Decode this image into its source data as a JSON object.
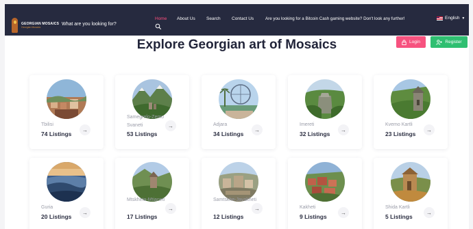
{
  "header": {
    "logo_title": "GEORGIAN MOSAICS",
    "logo_subtitle": "Georgian Mosaics",
    "search_prompt": "What are you looking for?",
    "nav": [
      {
        "label": "Home",
        "active": true
      },
      {
        "label": "About Us"
      },
      {
        "label": "Search"
      },
      {
        "label": "Contact Us"
      },
      {
        "label": "Are you looking for a Bitcoin Cash gaming website? Don't look any further!"
      }
    ],
    "language": "English"
  },
  "auth": {
    "login_label": "Login",
    "register_label": "Register"
  },
  "main": {
    "title": "Explore Georgian art of Mosaics",
    "regions": [
      {
        "name": "Tbilisi",
        "count": "74 Listings"
      },
      {
        "name": "Samegrelo-Zemo Svaneti",
        "count": "53 Listings"
      },
      {
        "name": "Adjara",
        "count": "34 Listings"
      },
      {
        "name": "Imereti",
        "count": "32 Listings"
      },
      {
        "name": "Kvemo Kartli",
        "count": "23 Listings"
      },
      {
        "name": "Guria",
        "count": "20 Listings"
      },
      {
        "name": "Mtskheta-Mtianeti",
        "count": "17 Listings"
      },
      {
        "name": "Samtskhe-Javakheti",
        "count": "12 Listings"
      },
      {
        "name": "Kakheti",
        "count": "9 Listings"
      },
      {
        "name": "Shida Kartli",
        "count": "5 Listings"
      }
    ]
  },
  "colors": {
    "topbar": "#262a3f",
    "accent_pink": "#f7527f",
    "accent_green": "#2fbf71",
    "active_nav": "#ff4f7e"
  },
  "icons": {
    "arrow": "arrow-right-icon",
    "search": "search-icon",
    "login": "lock-icon",
    "register": "user-plus-icon"
  }
}
